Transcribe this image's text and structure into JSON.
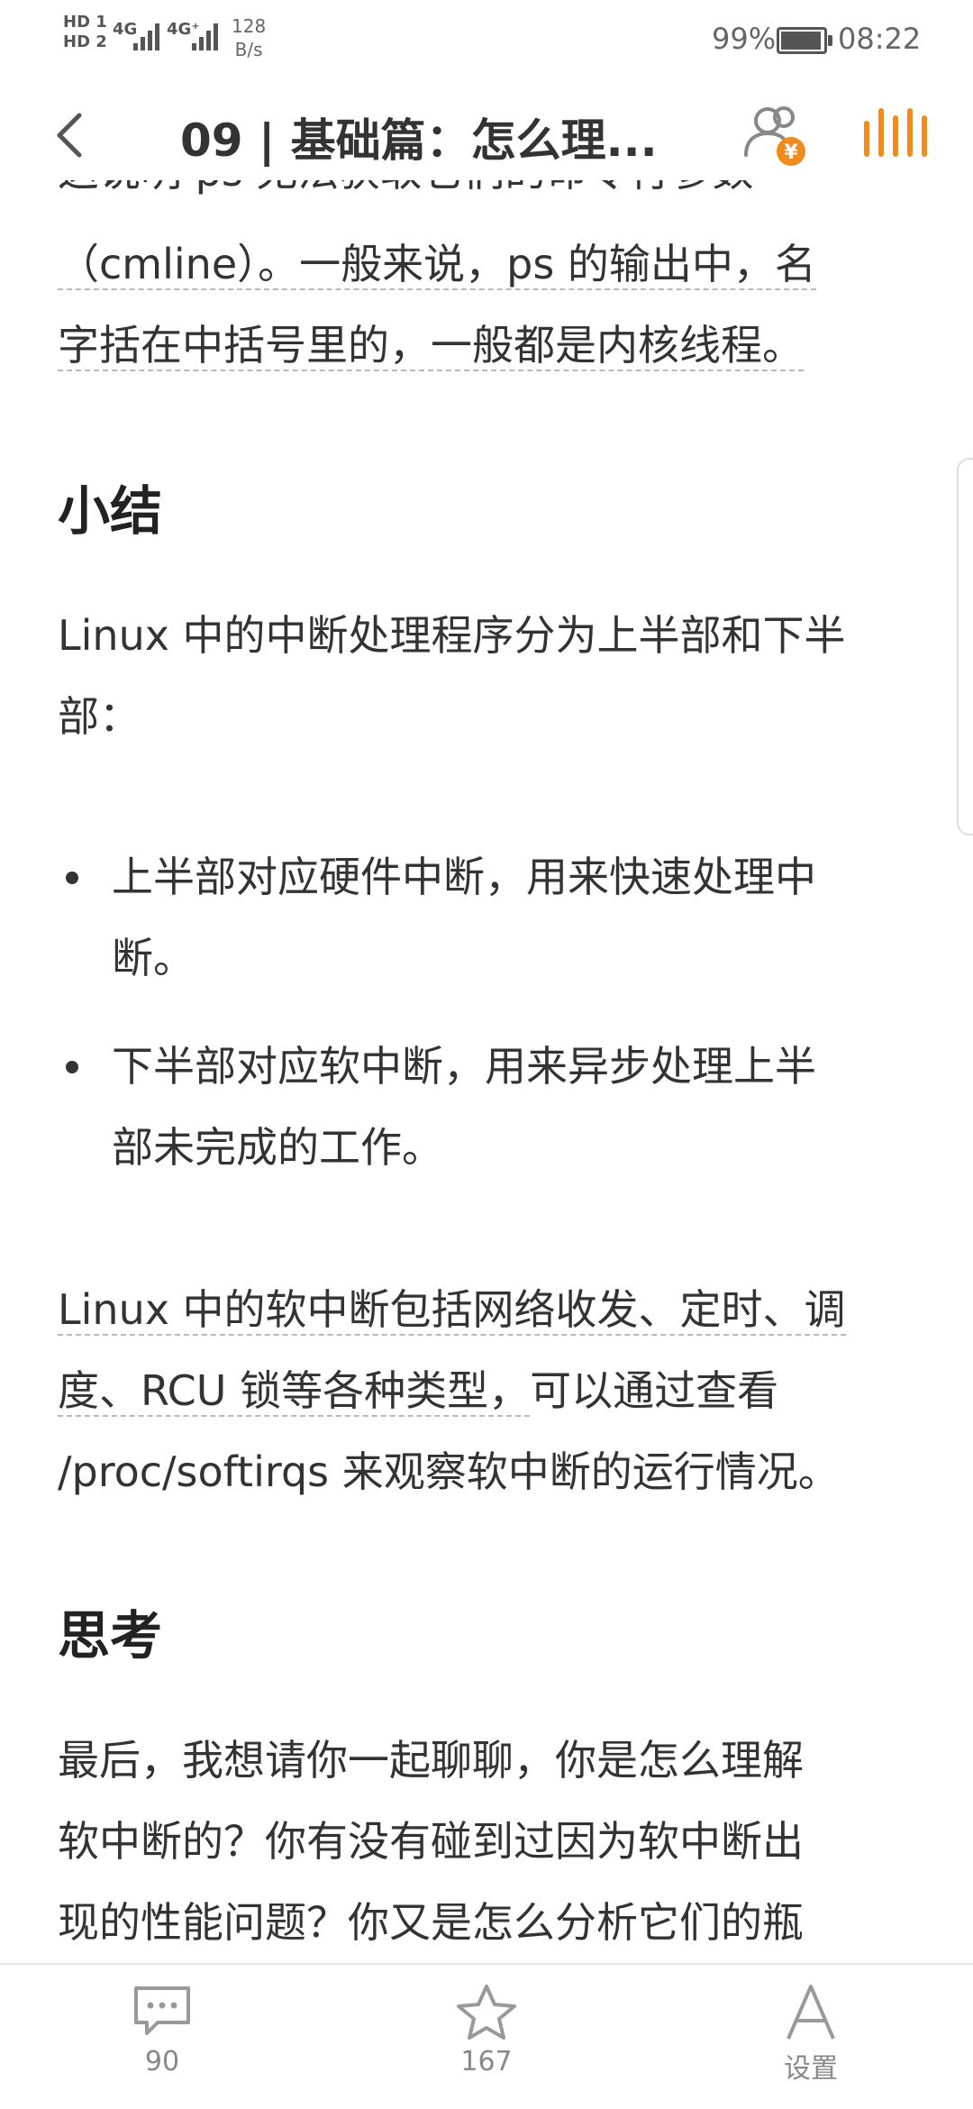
{
  "status_bar": {
    "hd1": "HD 1",
    "hd2": "HD 2",
    "net1": "4G",
    "net2": "4G⁺",
    "speed_value": "128",
    "speed_unit": "B/s",
    "battery_percent": "99%",
    "battery_level": 0.99,
    "time": "08:22"
  },
  "header": {
    "title": "09 | 基础篇：怎么理..."
  },
  "article": {
    "top_fragment": "这说明 ps 无法获取它们的命令行参数",
    "para1_line1": "（cmline）。一般来说，ps 的输出中，名",
    "para1_line2": "字括在中括号里的，一般都是内核线程。",
    "h_summary": "小结",
    "para2_line1": "Linux 中的中断处理程序分为上半部和下半",
    "para2_line2": "部：",
    "bullet1_line1": "上半部对应硬件中断，用来快速处理中",
    "bullet1_line2": "断。",
    "bullet2_line1": "下半部对应软中断，用来异步处理上半",
    "bullet2_line2": "部未完成的工作。",
    "para3_line1": "Linux 中的软中断包括网络收发、定时、调",
    "para3_line2a": "度、RCU 锁等各种类型，",
    "para3_line2b": "可以通过查看",
    "para3_line3": "/proc/softirqs 来观察软中断的运行情况。",
    "h_think": "思考",
    "para4_line1": "最后，我想请你一起聊聊，你是怎么理解",
    "para4_line2": "软中断的？你有没有碰到过因为软中断出",
    "para4_line3": "现的性能问题？你又是怎么分析它们的瓶"
  },
  "toolbar": {
    "comments_count": "90",
    "favorites_count": "167",
    "settings_label": "设置"
  },
  "colors": {
    "accent": "#f08c1e",
    "text": "#333333",
    "muted": "#888888"
  }
}
